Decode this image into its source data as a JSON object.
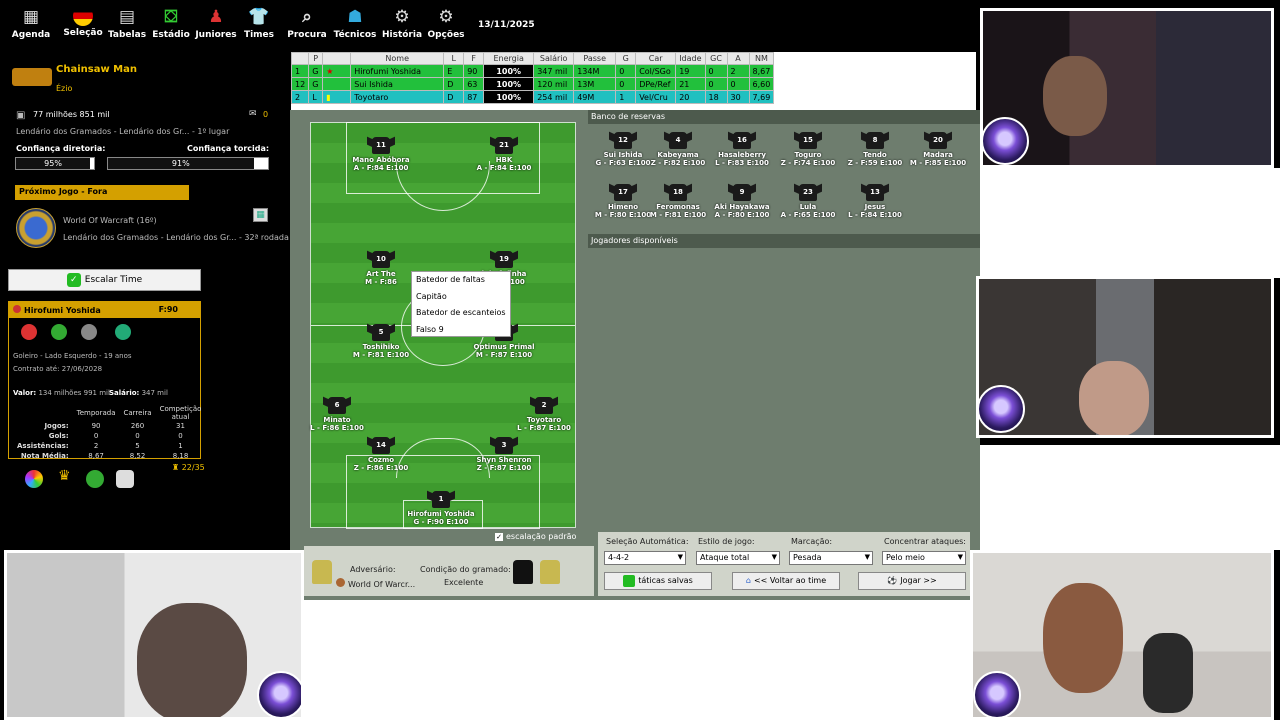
{
  "toolbar": {
    "items": [
      {
        "label": "Agenda",
        "icon": "calendar-icon"
      },
      {
        "label": "Seleção",
        "icon": "flag-icon"
      },
      {
        "label": "Tabelas",
        "icon": "table-icon"
      },
      {
        "label": "Estádio",
        "icon": "stadium-icon"
      },
      {
        "label": "Juniores",
        "icon": "junior-icon"
      },
      {
        "label": "Times",
        "icon": "shirt-icon"
      },
      {
        "label": "Procura",
        "icon": "search-icon"
      },
      {
        "label": "Técnicos",
        "icon": "coach-icon"
      },
      {
        "label": "História",
        "icon": "history-icon"
      },
      {
        "label": "Opções",
        "icon": "settings-icon"
      }
    ],
    "date": "13/11/2025"
  },
  "sidebar": {
    "club_name": "Chainsaw Man",
    "manager": "Ézio",
    "money": "77 milhões 851 mil",
    "messages": "0",
    "league": "Lendário dos Gramados - Lendário dos Gr... - 1º lugar",
    "conf_dir_label": "Confiança diretoria:",
    "conf_dir_value": "95%",
    "conf_dir_pct": 95,
    "conf_tor_label": "Confiança torcida:",
    "conf_tor_value": "91%",
    "conf_tor_pct": 91,
    "next_match_label": "Próximo Jogo - Fora",
    "opponent": "World Of Warcraft (16º)",
    "competition": "Lendário dos Gramados - Lendário dos Gr... - 32ª rodada",
    "escalar_button": "Escalar Time",
    "player": {
      "name": "Hirofumi Yoshida",
      "force": "F:90",
      "desc": "Goleiro - Lado Esquerdo - 19 anos",
      "contract": "Contrato até: 27/06/2028",
      "value_label": "Valor:",
      "value": "134 milhões 991 mil",
      "salary_label": "Salário:",
      "salary": "347 mil",
      "stats_headers": [
        "Temporada",
        "Carreira",
        "Competição atual"
      ],
      "stats": [
        {
          "label": "Jogos:",
          "values": [
            "90",
            "260",
            "31"
          ]
        },
        {
          "label": "Gols:",
          "values": [
            "0",
            "0",
            "0"
          ]
        },
        {
          "label": "Assistências:",
          "values": [
            "2",
            "5",
            "1"
          ]
        },
        {
          "label": "Nota Média:",
          "values": [
            "8,67",
            "8,52",
            "8,18"
          ]
        }
      ]
    },
    "squad_count": "22/35"
  },
  "squad_table": {
    "headers": [
      "",
      "P",
      "",
      "Nome",
      "L",
      "F",
      "Energia",
      "Salário",
      "Passe",
      "G",
      "Car",
      "Idade",
      "GC",
      "A",
      "NM"
    ],
    "rows": [
      {
        "num": "1",
        "pos": "G",
        "flag": "",
        "name": "Hirofumi Yoshida",
        "l": "E",
        "f": "90",
        "energy": "100%",
        "salary": "347 mil",
        "pass": "134M",
        "g": "0",
        "car": "Col/SGo",
        "age": "19",
        "gc": "0",
        "a": "2",
        "nm": "8,67",
        "style": "r-green"
      },
      {
        "num": "12",
        "pos": "G",
        "flag": "",
        "name": "Sui Ishida",
        "l": "D",
        "f": "63",
        "energy": "100%",
        "salary": "120 mil",
        "pass": "13M",
        "g": "0",
        "car": "DPe/Ref",
        "age": "21",
        "gc": "0",
        "a": "0",
        "nm": "6,60",
        "style": "r-green"
      },
      {
        "num": "2",
        "pos": "L",
        "flag": "",
        "name": "Toyotaro",
        "l": "D",
        "f": "87",
        "energy": "100%",
        "salary": "254 mil",
        "pass": "49M",
        "g": "1",
        "car": "Vel/Cru",
        "age": "20",
        "gc": "18",
        "a": "30",
        "nm": "7,69",
        "style": "r-cyan"
      }
    ]
  },
  "pitch": {
    "players": [
      {
        "num": "11",
        "name": "Mano Abóbora",
        "info": "A - F:84 E:100"
      },
      {
        "num": "21",
        "name": "HBK",
        "info": "A - F:84 E:100"
      },
      {
        "num": "10",
        "name": "Art The",
        "info": "M - F:86"
      },
      {
        "num": "19",
        "name": "inhafofinha",
        "info": "F:86 E:100"
      },
      {
        "num": "5",
        "name": "Toshihiko",
        "info": "M - F:81 E:100"
      },
      {
        "num": "7",
        "name": "Optimus Primal",
        "info": "M - F:87 E:100"
      },
      {
        "num": "6",
        "name": "Minato",
        "info": "L - F:86 E:100"
      },
      {
        "num": "2",
        "name": "Toyotaro",
        "info": "L - F:87 E:100"
      },
      {
        "num": "14",
        "name": "Cozmo",
        "info": "Z - F:86 E:100"
      },
      {
        "num": "3",
        "name": "Shyn Shenron",
        "info": "Z - F:87 E:100"
      },
      {
        "num": "1",
        "name": "Hirofumi Yoshida",
        "info": "G - F:90 E:100"
      }
    ],
    "context_menu": [
      "Batedor de faltas",
      "Capitão",
      "Batedor de escanteios",
      "Falso 9"
    ],
    "default_lineup": "escalação padrão"
  },
  "bench": {
    "title": "Banco de reservas",
    "available_title": "Jogadores disponíveis",
    "players": [
      {
        "num": "12",
        "name": "Sui Ishida",
        "info": "G - F:63 E:100"
      },
      {
        "num": "4",
        "name": "Kabeyama",
        "info": "Z - F:82 E:100"
      },
      {
        "num": "16",
        "name": "Hasaleberry",
        "info": "L - F:83 E:100"
      },
      {
        "num": "15",
        "name": "Toguro",
        "info": "Z - F:74 E:100"
      },
      {
        "num": "8",
        "name": "Tendo",
        "info": "Z - F:59 E:100"
      },
      {
        "num": "20",
        "name": "Madara",
        "info": "M - F:85 E:100"
      },
      {
        "num": "17",
        "name": "Himeno",
        "info": "M - F:80 E:100"
      },
      {
        "num": "18",
        "name": "Feromonas",
        "info": "M - F:81 E:100"
      },
      {
        "num": "9",
        "name": "Aki Hayakawa",
        "info": "A - F:80 E:100"
      },
      {
        "num": "23",
        "name": "Lula",
        "info": "A - F:65 E:100"
      },
      {
        "num": "13",
        "name": "Jesus",
        "info": "L - F:84 E:100"
      }
    ]
  },
  "match_info": {
    "adversario_label": "Adversário:",
    "adversario": "World Of Warcr...",
    "gramado_label": "Condição do gramado:",
    "gramado": "Excelente"
  },
  "controls": {
    "selecao_label": "Seleção Automática:",
    "selecao": "4-4-2",
    "estilo_label": "Estilo de jogo:",
    "estilo": "Ataque total",
    "marcacao_label": "Marcação:",
    "marcacao": "Pesada",
    "concentrar_label": "Concentrar ataques:",
    "concentrar": "Pelo meio",
    "taticas_button": "táticas salvas",
    "voltar_button": "<< Voltar ao time",
    "jogar_button": "Jogar >>"
  }
}
